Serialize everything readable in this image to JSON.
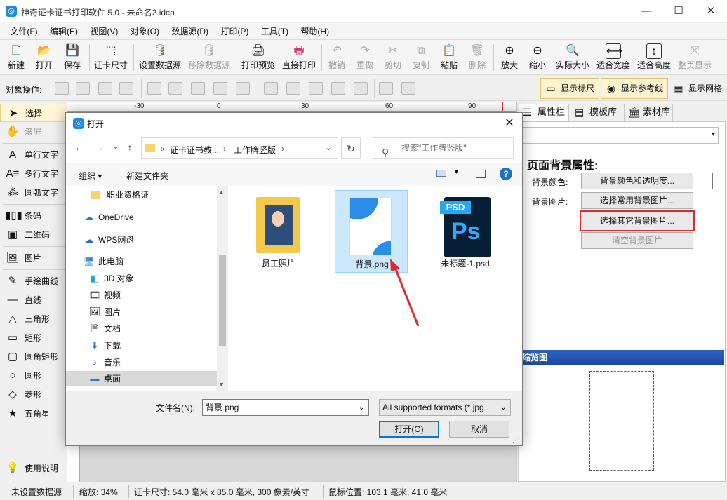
{
  "window": {
    "title": "神奇证卡证书打印软件 5.0 - 未命名2.idcp",
    "min": "—",
    "max": "☐",
    "close": "✕"
  },
  "menu": [
    "文件(F)",
    "编辑(E)",
    "视图(V)",
    "对象(O)",
    "数据源(D)",
    "打印(P)",
    "工具(T)",
    "帮助(H)"
  ],
  "toolbar": [
    {
      "label": "新建",
      "icon": "new-file-icon",
      "glyph": "🗋"
    },
    {
      "label": "打开",
      "icon": "open-icon",
      "glyph": "📂"
    },
    {
      "label": "保存",
      "icon": "save-icon",
      "glyph": "💾"
    },
    {
      "label": "证卡尺寸",
      "icon": "card-size-icon",
      "glyph": "⬚"
    },
    {
      "label": "设置数据源",
      "icon": "database-icon",
      "glyph": "🛢"
    },
    {
      "label": "移除数据源",
      "icon": "remove-database-icon",
      "glyph": "🛢"
    },
    {
      "label": "打印预览",
      "icon": "print-preview-icon",
      "glyph": "🖨"
    },
    {
      "label": "直接打印",
      "icon": "printer-icon",
      "glyph": "🖶"
    },
    {
      "label": "撤销",
      "icon": "undo-icon",
      "glyph": "↶"
    },
    {
      "label": "重做",
      "icon": "redo-icon",
      "glyph": "↷"
    },
    {
      "label": "剪切",
      "icon": "cut-icon",
      "glyph": "✂"
    },
    {
      "label": "复制",
      "icon": "copy-icon",
      "glyph": "⧉"
    },
    {
      "label": "粘贴",
      "icon": "paste-icon",
      "glyph": "📋"
    },
    {
      "label": "删除",
      "icon": "delete-icon",
      "glyph": "🗑"
    },
    {
      "label": "放大",
      "icon": "zoom-in-icon",
      "glyph": "⊕"
    },
    {
      "label": "缩小",
      "icon": "zoom-out-icon",
      "glyph": "⊖"
    },
    {
      "label": "实际大小",
      "icon": "actual-size-icon",
      "glyph": "🔍"
    },
    {
      "label": "适合宽度",
      "icon": "fit-width-icon",
      "glyph": "⟷"
    },
    {
      "label": "适合高度",
      "icon": "fit-height-icon",
      "glyph": "↕"
    },
    {
      "label": "整页显示",
      "icon": "fit-page-icon",
      "glyph": "⤧"
    }
  ],
  "toolbar2": {
    "label": "对象操作:",
    "show_ruler": "显示标尺",
    "show_guides": "显示参考线",
    "show_grid": "显示网格"
  },
  "lefttools": [
    "选择",
    "滚屏",
    "单行文字",
    "多行文字",
    "圆弧文字",
    "条码",
    "二维码",
    "图片",
    "手绘曲线",
    "直线",
    "三角形",
    "矩形",
    "圆角矩形",
    "圆形",
    "菱形",
    "五角星",
    "使用说明"
  ],
  "ruler": [
    "-30",
    "0",
    "30",
    "60",
    "90"
  ],
  "rightpanel": {
    "tabs": [
      "属性栏",
      "模板库",
      "素材库"
    ],
    "section_title": "页面背景属性:",
    "bg_color_label": "背景颜色:",
    "bg_color_btn": "背景颜色和透明度...",
    "bg_image_label": "背景图片:",
    "common_bg_btn": "选择常用背景图片...",
    "other_bg_btn": "选择其它背景图片...",
    "clear_bg_btn": "清空背景图片",
    "preview_title": "缩览图"
  },
  "status": [
    "未设置数据源",
    "缩放: 34%",
    "证卡尺寸: 54.0 毫米 x 85.0 毫米, 300 像素/英寸",
    "鼠标位置: 103.1 毫米, 41.0 毫米"
  ],
  "dialog": {
    "title": "打开",
    "breadcrumb": [
      "«",
      "证卡证书教...",
      "›",
      "工作牌竖版",
      "›"
    ],
    "search_placeholder": "搜索\"工作牌竖版\"",
    "organize": "组织 ▾",
    "new_folder": "新建文件夹",
    "nav": [
      {
        "label": "职业资格证",
        "icon": "folder-icon"
      },
      {
        "label": "OneDrive",
        "icon": "cloud-icon"
      },
      {
        "label": "WPS网盘",
        "icon": "cloud-icon"
      },
      {
        "label": "此电脑",
        "icon": "computer-icon"
      },
      {
        "label": "3D 对象",
        "icon": "cube-icon"
      },
      {
        "label": "视频",
        "icon": "video-icon"
      },
      {
        "label": "图片",
        "icon": "pictures-icon"
      },
      {
        "label": "文档",
        "icon": "document-icon"
      },
      {
        "label": "下载",
        "icon": "download-icon"
      },
      {
        "label": "音乐",
        "icon": "music-icon"
      },
      {
        "label": "桌面",
        "icon": "desktop-icon"
      }
    ],
    "files": [
      {
        "label": "员工照片",
        "type": "folder"
      },
      {
        "label": "背景.png",
        "type": "png"
      },
      {
        "label": "未标题-1.psd",
        "type": "psd"
      }
    ],
    "filename_label": "文件名(N):",
    "filename_value": "背景.png",
    "filetype_value": "All supported formats (*.jpg",
    "open_btn": "打开(O)",
    "cancel_btn": "取消",
    "psd_tag": "PSD",
    "ps_text": "Ps"
  }
}
